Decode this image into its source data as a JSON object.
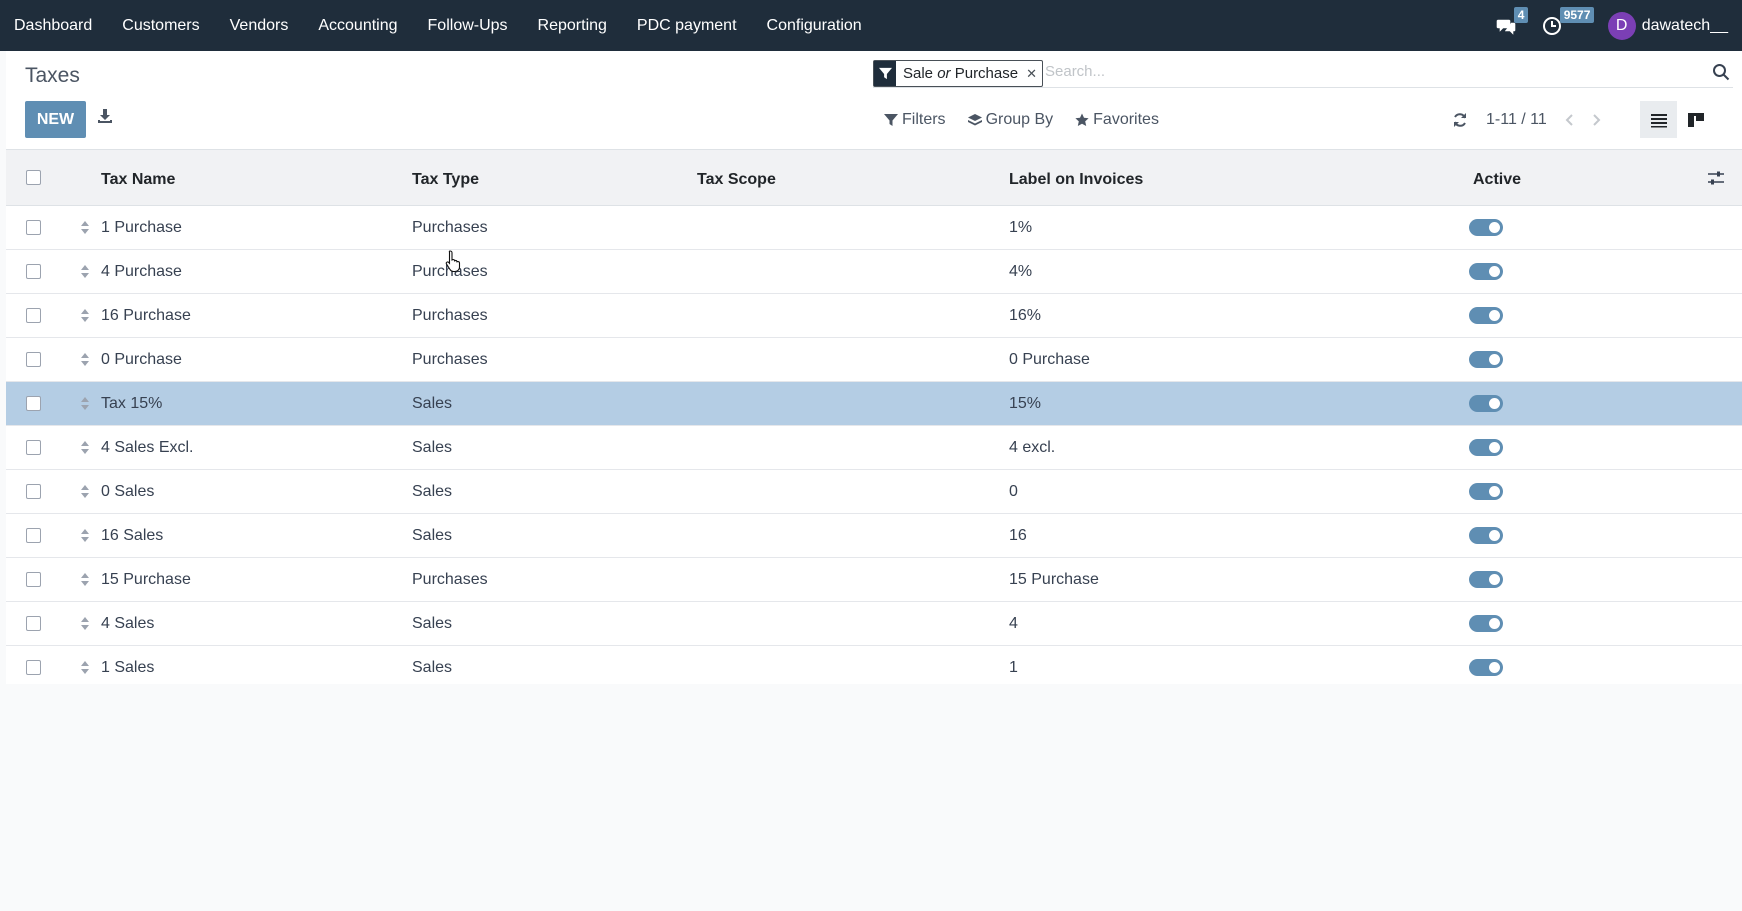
{
  "navbar": {
    "menu": [
      "Dashboard",
      "Customers",
      "Vendors",
      "Accounting",
      "Follow-Ups",
      "Reporting",
      "PDC payment",
      "Configuration"
    ],
    "messages_count": "4",
    "activities_count": "9577",
    "user_initial": "D",
    "user_name": "dawatech__"
  },
  "control": {
    "title": "Taxes",
    "new_label": "NEW",
    "facet": {
      "left": "Sale",
      "or": "or",
      "right": "Purchase"
    },
    "search_placeholder": "Search...",
    "filters_label": "Filters",
    "groupby_label": "Group By",
    "favorites_label": "Favorites",
    "pager": "1-11 / 11"
  },
  "table": {
    "headers": {
      "name": "Tax Name",
      "type": "Tax Type",
      "scope": "Tax Scope",
      "label": "Label on Invoices",
      "active": "Active"
    },
    "rows": [
      {
        "name": "1 Purchase",
        "type": "Purchases",
        "scope": "",
        "label": "1%",
        "active": true,
        "selected": false
      },
      {
        "name": "4 Purchase",
        "type": "Purchases",
        "scope": "",
        "label": "4%",
        "active": true,
        "selected": false
      },
      {
        "name": "16 Purchase",
        "type": "Purchases",
        "scope": "",
        "label": "16%",
        "active": true,
        "selected": false
      },
      {
        "name": "0 Purchase",
        "type": "Purchases",
        "scope": "",
        "label": "0 Purchase",
        "active": true,
        "selected": false
      },
      {
        "name": "Tax 15%",
        "type": "Sales",
        "scope": "",
        "label": "15%",
        "active": true,
        "selected": true
      },
      {
        "name": "4 Sales Excl.",
        "type": "Sales",
        "scope": "",
        "label": "4 excl.",
        "active": true,
        "selected": false
      },
      {
        "name": "0 Sales",
        "type": "Sales",
        "scope": "",
        "label": "0",
        "active": true,
        "selected": false
      },
      {
        "name": "16 Sales",
        "type": "Sales",
        "scope": "",
        "label": "16",
        "active": true,
        "selected": false
      },
      {
        "name": "15 Purchase",
        "type": "Purchases",
        "scope": "",
        "label": "15 Purchase",
        "active": true,
        "selected": false
      },
      {
        "name": "4 Sales",
        "type": "Sales",
        "scope": "",
        "label": "4",
        "active": true,
        "selected": false
      },
      {
        "name": "1 Sales",
        "type": "Sales",
        "scope": "",
        "label": "1",
        "active": true,
        "selected": false
      }
    ]
  },
  "colors": {
    "navbar": "#1f2d3b",
    "primary": "#5f8eb3",
    "selected_row": "#b4cde4",
    "avatar": "#7b3fb5"
  }
}
